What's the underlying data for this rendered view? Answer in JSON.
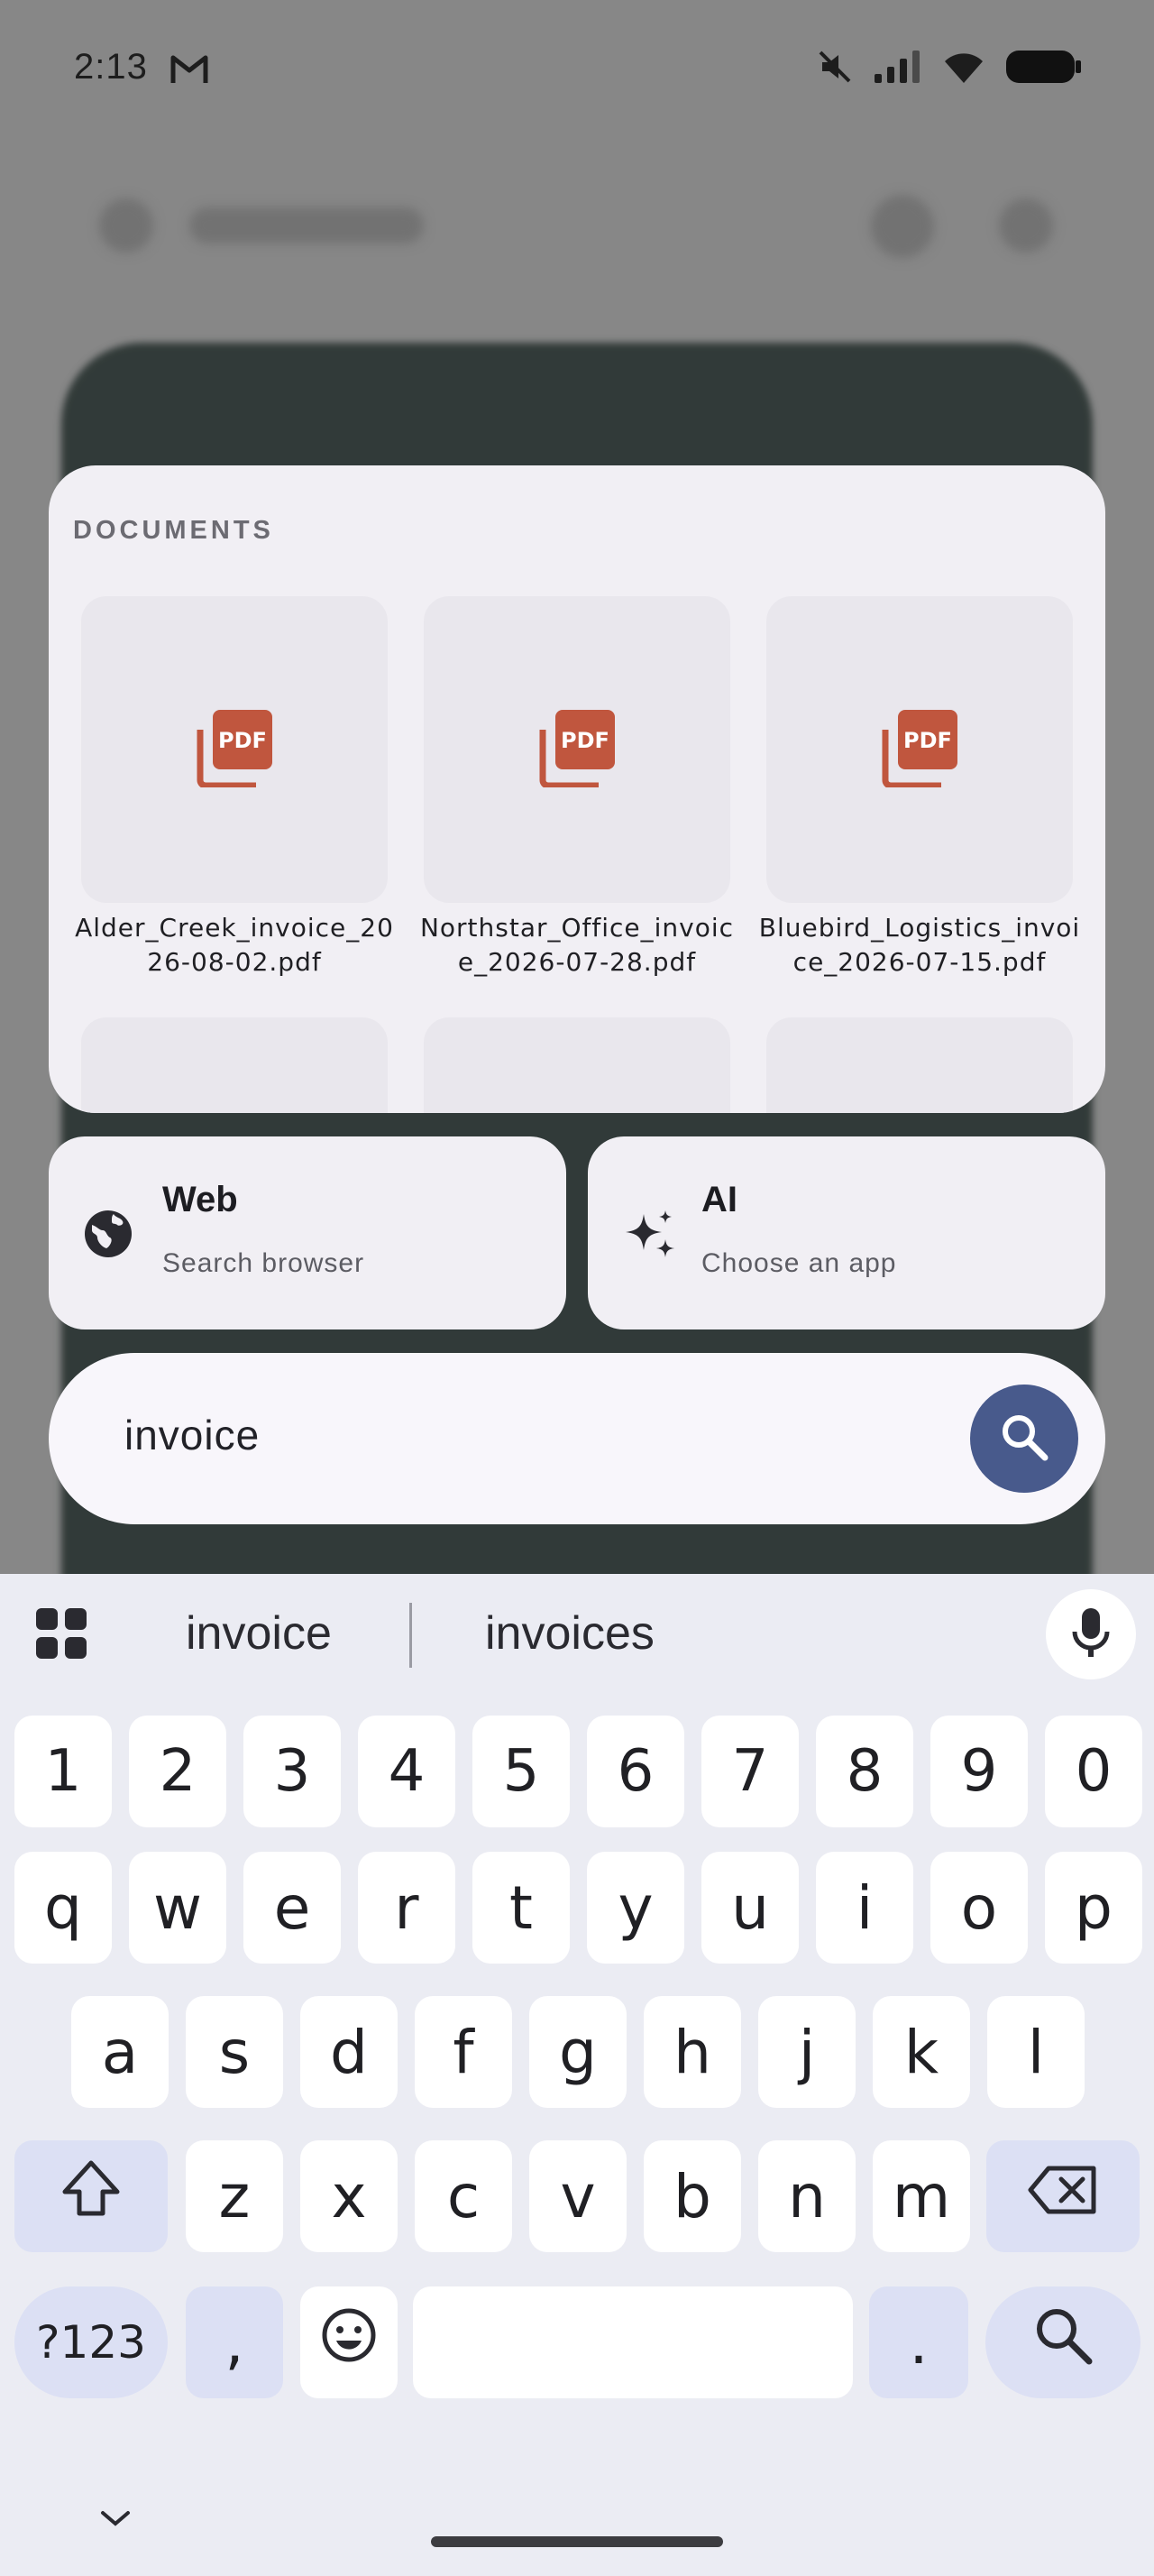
{
  "status_bar": {
    "time": "2:13",
    "icons": [
      "gmail-icon",
      "mute-icon",
      "signal-icon",
      "wifi-icon",
      "battery-icon"
    ]
  },
  "documents": {
    "header": "DOCUMENTS",
    "items": [
      {
        "name": "Alder_Creek_invoice_2026-08-02.pdf",
        "icon": "pdf-icon"
      },
      {
        "name": "Northstar_Office_invoice_2026-07-28.pdf",
        "icon": "pdf-icon"
      },
      {
        "name": "Bluebird_Logistics_invoice_2026-07-15.pdf",
        "icon": "pdf-icon"
      }
    ],
    "pdf_label": "PDF",
    "pdf_color": "#c0563e"
  },
  "actions": [
    {
      "title": "Web",
      "subtitle": "Search browser",
      "icon": "globe-icon"
    },
    {
      "title": "AI",
      "subtitle": "Choose an app",
      "icon": "sparkle-icon"
    }
  ],
  "search": {
    "query": "invoice",
    "button_icon": "search-icon",
    "button_color": "#485a8c"
  },
  "keyboard": {
    "suggestions": [
      "invoice",
      "invoices"
    ],
    "number_row": [
      "1",
      "2",
      "3",
      "4",
      "5",
      "6",
      "7",
      "8",
      "9",
      "0"
    ],
    "row1": [
      "q",
      "w",
      "e",
      "r",
      "t",
      "y",
      "u",
      "i",
      "o",
      "p"
    ],
    "row2": [
      "a",
      "s",
      "d",
      "f",
      "g",
      "h",
      "j",
      "k",
      "l"
    ],
    "row3": [
      "z",
      "x",
      "c",
      "v",
      "b",
      "n",
      "m"
    ],
    "symbols_label": "?123",
    "comma_label": ",",
    "period_label": "."
  }
}
